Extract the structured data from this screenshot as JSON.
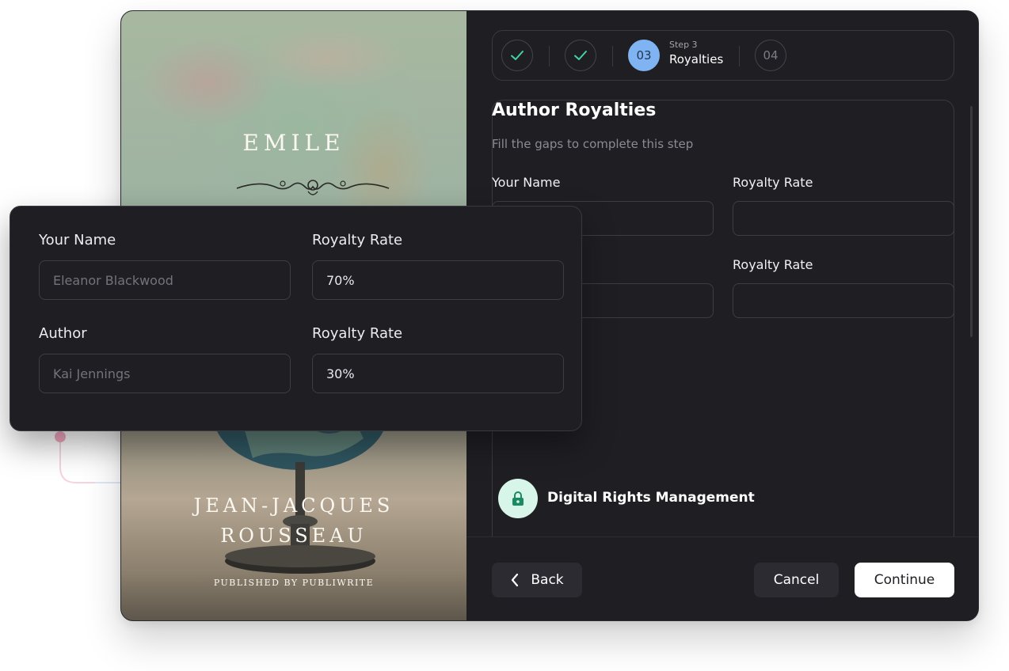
{
  "cover": {
    "title": "EMILE",
    "author_line1": "JEAN-JACQUES",
    "author_line2": "ROUSSEAU",
    "publisher": "PUBLISHED BY PUBLIWRITE"
  },
  "stepper": {
    "steps": [
      {
        "state": "done",
        "icon": "check-icon"
      },
      {
        "state": "done",
        "icon": "check-icon"
      },
      {
        "state": "active",
        "number": "03",
        "kicker": "Step 3",
        "label": "Royalties"
      },
      {
        "state": "upcoming",
        "number": "04"
      }
    ]
  },
  "form": {
    "title": "Author Royalties",
    "subtitle": "Fill the gaps to complete this step",
    "row1": {
      "name_label": "Your Name",
      "rate_label": "Royalty Rate"
    },
    "row2": {
      "rate_label": "Royalty Rate"
    },
    "drm_label": "Digital Rights Management",
    "drm_icon": "lock-icon"
  },
  "footer": {
    "back_label": "Back",
    "cancel_label": "Cancel",
    "continue_label": "Continue"
  },
  "floating_card": {
    "row1": {
      "name_label": "Your Name",
      "name_placeholder": "Eleanor Blackwood",
      "rate_label": "Royalty Rate",
      "rate_value": "70%"
    },
    "row2": {
      "name_label": "Author",
      "name_placeholder": "Kai Jennings",
      "rate_label": "Royalty Rate",
      "rate_value": "30%"
    }
  },
  "colors": {
    "panel_bg": "#1f1e23",
    "accent_step": "#7fb3f2",
    "check_green": "#3fd6a0",
    "drm_icon_bg": "#d7f5e8",
    "drm_icon_fg": "#1a8a63"
  }
}
